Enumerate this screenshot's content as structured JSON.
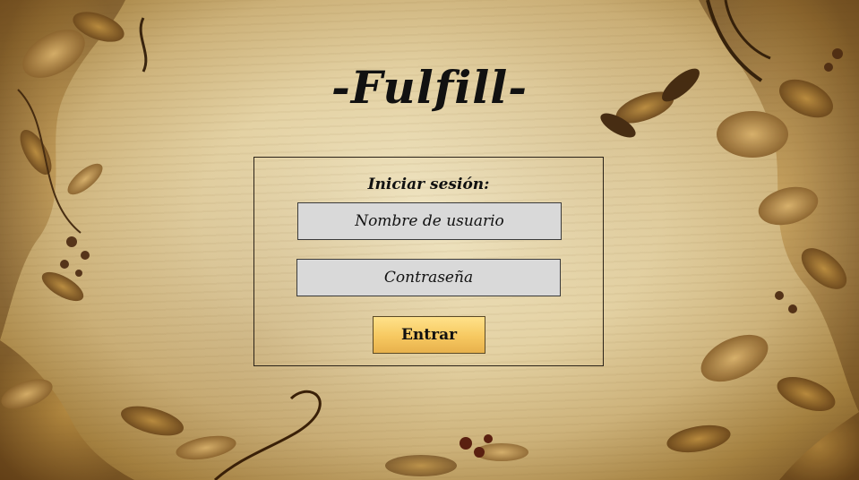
{
  "app": {
    "title": "-Fulfill-"
  },
  "login": {
    "heading": "Iniciar sesión:",
    "username_placeholder": "Nombre de usuario",
    "password_placeholder": "Contraseña",
    "submit_label": "Entrar"
  },
  "colors": {
    "button_gradient_top": "#ffe28a",
    "button_gradient_bottom": "#e8b14c",
    "field_background": "#d9d9d9",
    "text": "#111111"
  }
}
